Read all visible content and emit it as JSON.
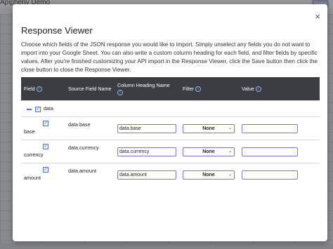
{
  "background": {
    "title": "Apipheny Demo",
    "share_label": "Share"
  },
  "modal": {
    "title": "Response Viewer",
    "close_glyph": "×",
    "description": "Choose which fields of the JSON response you would like to import. Simply unselect any fields you do not want to import into your Google Sheet. You can also write a custom column heading for each field, and filter fields by specific values. After you're finished customizing your API import in the Response Viewer, click the Save button then click the close button to close the Response Viewer."
  },
  "table": {
    "headers": {
      "field": "Field",
      "source": "Source Field Name",
      "heading": "Column Heading Name",
      "filter": "Filter",
      "value": "Value"
    },
    "root": {
      "label": "data",
      "checked": true
    },
    "rows": [
      {
        "field": "base",
        "source": "data.base",
        "heading": "data.base",
        "filter": "None",
        "value": "",
        "checked": true
      },
      {
        "field": "currency",
        "source": "data.currency",
        "heading": "data.currency",
        "filter": "None",
        "value": "",
        "checked": true
      },
      {
        "field": "amount",
        "source": "data.amount",
        "heading": "data.amount",
        "filter": "None",
        "value": "",
        "checked": true
      }
    ]
  },
  "colors": {
    "header_bg": "#3a3d42",
    "input_border": "#7d78d4",
    "accent": "#4a77d4"
  },
  "icons": {
    "info": "info-icon",
    "checkbox": "checkbox-icon",
    "collapse": "collapse-icon",
    "caret": "caret-icon"
  }
}
